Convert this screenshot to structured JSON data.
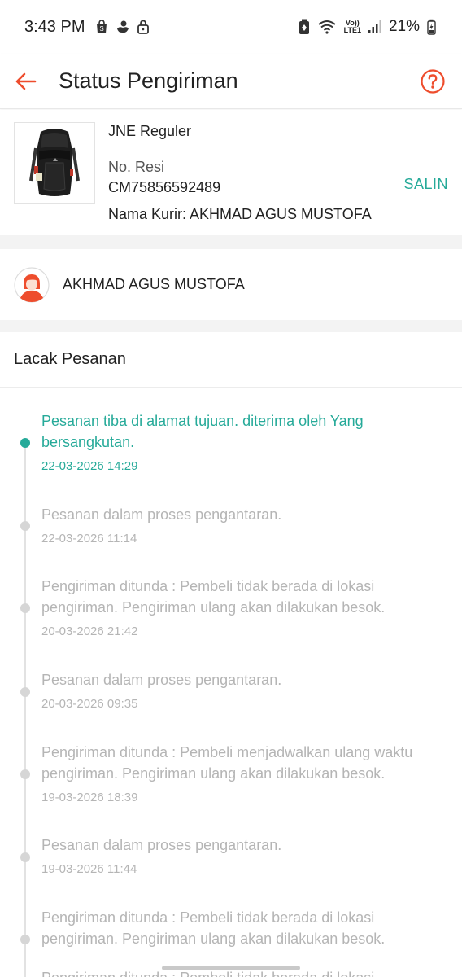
{
  "status_bar": {
    "time": "3:43 PM",
    "volte_line1": "Vo))",
    "volte_line2": "LTE1",
    "battery": "21%"
  },
  "app_bar": {
    "title": "Status Pengiriman",
    "back_icon": "back-arrow-icon",
    "help_icon": "help-circle-icon"
  },
  "shipment": {
    "courier": "JNE Reguler",
    "resi_label": "No. Resi",
    "resi_number": "CM75856592489",
    "copy_label": "SALIN",
    "courier_name": "Nama Kurir: AKHMAD AGUS MUSTOFA"
  },
  "recipient": {
    "name": "AKHMAD AGUS MUSTOFA"
  },
  "tracking": {
    "title": "Lacak Pesanan",
    "events": [
      {
        "message": "Pesanan tiba di alamat tujuan. diterima oleh Yang bersangkutan.",
        "time": "22-03-2026 14:29",
        "active": true
      },
      {
        "message": "Pesanan dalam proses pengantaran.",
        "time": "22-03-2026 11:14",
        "active": false
      },
      {
        "message": "Pengiriman ditunda : Pembeli tidak berada di lokasi pengiriman. Pengiriman ulang akan dilakukan besok.",
        "time": "20-03-2026 21:42",
        "active": false
      },
      {
        "message": "Pesanan dalam proses pengantaran.",
        "time": "20-03-2026 09:35",
        "active": false
      },
      {
        "message": "Pengiriman ditunda : Pembeli menjadwalkan ulang waktu pengiriman. Pengiriman ulang akan dilakukan besok.",
        "time": "19-03-2026 18:39",
        "active": false
      },
      {
        "message": "Pesanan dalam proses pengantaran.",
        "time": "19-03-2026 11:44",
        "active": false
      },
      {
        "message": "Pengiriman ditunda : Pembeli tidak berada di lokasi pengiriman. Pengiriman ulang akan dilakukan besok.",
        "time": "",
        "active": false
      },
      {
        "message": "Pengiriman ditunda : Pembeli tidak berada di lokasi",
        "time": "",
        "active": false
      }
    ]
  },
  "colors": {
    "accent_orange": "#ee4d2d",
    "accent_teal": "#26aa99",
    "muted_text": "#b5b5b5"
  }
}
